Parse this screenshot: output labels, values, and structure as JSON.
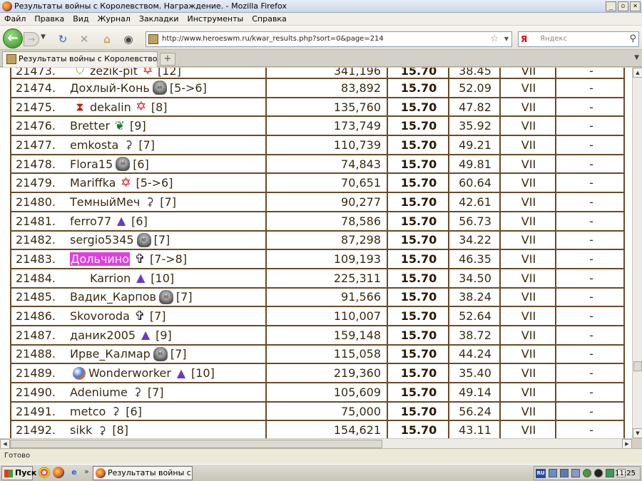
{
  "window": {
    "title": "Результаты войны с Королевством. Награждение. - Mozilla Firefox",
    "controls": [
      "_",
      "▫",
      "×"
    ]
  },
  "menu": [
    "Файл",
    "Правка",
    "Вид",
    "Журнал",
    "Закладки",
    "Инструменты",
    "Справка"
  ],
  "nav": {
    "url": "http://www.heroeswm.ru/kwar_results.php?sort=0&page=214",
    "search_placeholder": "Яндекс",
    "search_engine_letter": "Я"
  },
  "tabs": [
    {
      "label": "Результаты войны с Королевство..."
    }
  ],
  "rows": [
    {
      "num": "21473.",
      "pre_icon": "shield",
      "name": "zezik-pit",
      "icon": "star",
      "level": "[12]",
      "points": "341,196",
      "coef": "15.70",
      "pct": "38.45",
      "rank": "VII",
      "dash": "-"
    },
    {
      "num": "21474.",
      "pre_icon": "",
      "name": "Дохлый-Конь",
      "icon": "skull",
      "level": "[5->6]",
      "points": "83,892",
      "coef": "15.70",
      "pct": "52.09",
      "rank": "VII",
      "dash": "-"
    },
    {
      "num": "21475.",
      "pre_icon": "hourglass",
      "name": "dekalin",
      "icon": "star",
      "level": "[8]",
      "points": "135,760",
      "coef": "15.70",
      "pct": "47.82",
      "rank": "VII",
      "dash": "-"
    },
    {
      "num": "21476.",
      "pre_icon": "",
      "name": "Bretter",
      "icon": "leaf",
      "level": "[9]",
      "points": "173,749",
      "coef": "15.70",
      "pct": "35.92",
      "rank": "VII",
      "dash": "-"
    },
    {
      "num": "21477.",
      "pre_icon": "",
      "name": "emkosta",
      "icon": "scythe",
      "level": "[7]",
      "points": "110,739",
      "coef": "15.70",
      "pct": "49.21",
      "rank": "VII",
      "dash": "-"
    },
    {
      "num": "21478.",
      "pre_icon": "",
      "name": "Flora15",
      "icon": "skull",
      "level": "[6]",
      "points": "74,843",
      "coef": "15.70",
      "pct": "49.81",
      "rank": "VII",
      "dash": "-"
    },
    {
      "num": "21479.",
      "pre_icon": "",
      "name": "Mariffka",
      "icon": "star",
      "level": "[5->6]",
      "points": "70,651",
      "coef": "15.70",
      "pct": "60.64",
      "rank": "VII",
      "dash": "-"
    },
    {
      "num": "21480.",
      "pre_icon": "",
      "name": "ТемныйМеч",
      "icon": "scythe",
      "level": "[7]",
      "points": "90,277",
      "coef": "15.70",
      "pct": "42.61",
      "rank": "VII",
      "dash": "-"
    },
    {
      "num": "21481.",
      "pre_icon": "",
      "name": "ferro77",
      "icon": "hat",
      "level": "[6]",
      "points": "78,586",
      "coef": "15.70",
      "pct": "56.73",
      "rank": "VII",
      "dash": "-"
    },
    {
      "num": "21482.",
      "pre_icon": "",
      "name": "sergio5345",
      "icon": "skull",
      "level": "[7]",
      "points": "87,298",
      "coef": "15.70",
      "pct": "34.22",
      "rank": "VII",
      "dash": "-"
    },
    {
      "num": "21483.",
      "pre_icon": "",
      "name": "Дольчино",
      "icon": "cross",
      "level": "[7->8]",
      "points": "109,193",
      "coef": "15.70",
      "pct": "46.35",
      "rank": "VII",
      "dash": "-",
      "highlight": true
    },
    {
      "num": "21484.",
      "pre_icon": "blank",
      "name": "Karrion",
      "icon": "hat",
      "level": "[10]",
      "points": "225,311",
      "coef": "15.70",
      "pct": "34.50",
      "rank": "VII",
      "dash": "-"
    },
    {
      "num": "21485.",
      "pre_icon": "",
      "name": "Вадик_Карпов",
      "icon": "skull",
      "level": "[7]",
      "points": "91,566",
      "coef": "15.70",
      "pct": "38.24",
      "rank": "VII",
      "dash": "-"
    },
    {
      "num": "21486.",
      "pre_icon": "",
      "name": "Skovoroda",
      "icon": "cross",
      "level": "[7]",
      "points": "110,007",
      "coef": "15.70",
      "pct": "52.64",
      "rank": "VII",
      "dash": "-"
    },
    {
      "num": "21487.",
      "pre_icon": "",
      "name": "даник2005",
      "icon": "hat",
      "level": "[9]",
      "points": "159,148",
      "coef": "15.70",
      "pct": "38.72",
      "rank": "VII",
      "dash": "-"
    },
    {
      "num": "21488.",
      "pre_icon": "",
      "name": "Ирве_Калмар",
      "icon": "skull",
      "level": "[7]",
      "points": "115,058",
      "coef": "15.70",
      "pct": "44.24",
      "rank": "VII",
      "dash": "-"
    },
    {
      "num": "21489.",
      "pre_icon": "orb",
      "name": "Wonderworker",
      "icon": "hat",
      "level": "[10]",
      "points": "219,360",
      "coef": "15.70",
      "pct": "35.40",
      "rank": "VII",
      "dash": "-"
    },
    {
      "num": "21490.",
      "pre_icon": "",
      "name": "Adeniume",
      "icon": "scythe",
      "level": "[7]",
      "points": "105,609",
      "coef": "15.70",
      "pct": "49.14",
      "rank": "VII",
      "dash": "-"
    },
    {
      "num": "21491.",
      "pre_icon": "",
      "name": "metco",
      "icon": "scythe",
      "level": "[6]",
      "points": "75,000",
      "coef": "15.70",
      "pct": "56.24",
      "rank": "VII",
      "dash": "-"
    },
    {
      "num": "21492.",
      "pre_icon": "",
      "name": "sikk",
      "icon": "scythe",
      "level": "[8]",
      "points": "154,621",
      "coef": "15.70",
      "pct": "43.11",
      "rank": "VII",
      "dash": "-"
    }
  ],
  "status": {
    "text": "Готово"
  },
  "taskbar": {
    "start_label": "Пуск",
    "task_label": "Результаты войны с...",
    "lang": "RU",
    "clock": "11:25"
  },
  "colors": {
    "table_border": "#6b4a26",
    "highlight_bg": "#e040e0",
    "text": "#3a2a10"
  }
}
